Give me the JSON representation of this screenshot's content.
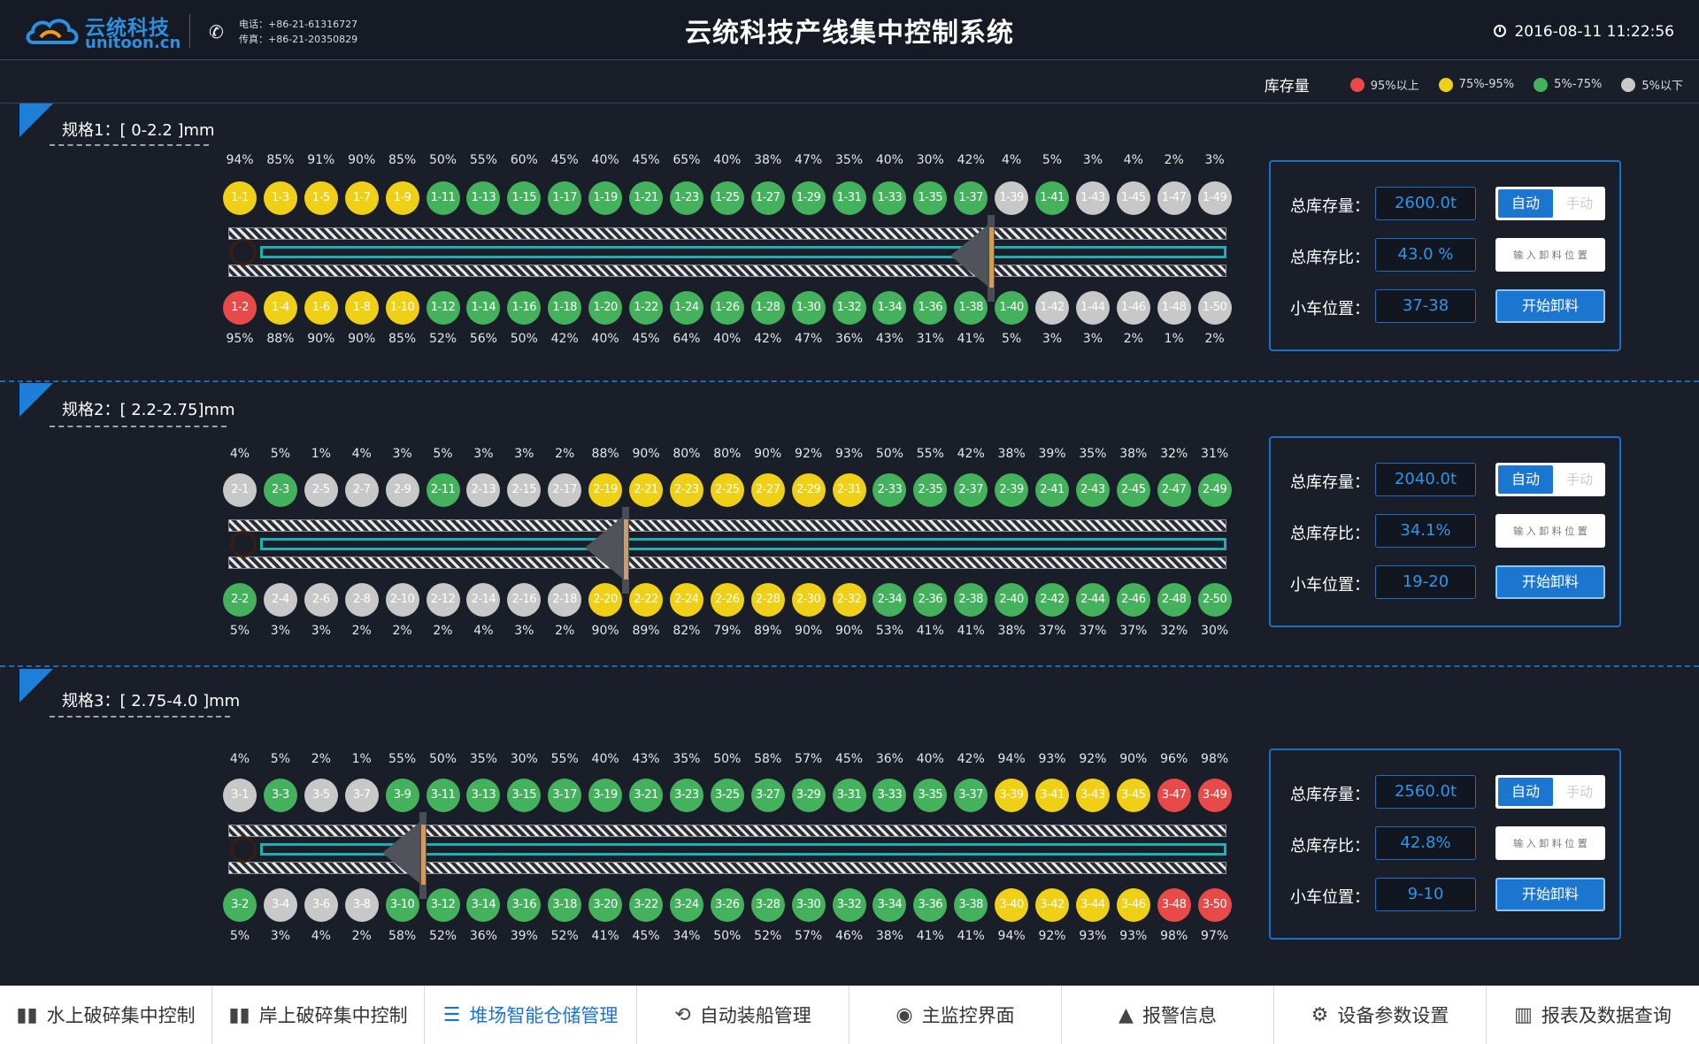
{
  "header": {
    "logo_cn": "云统科技",
    "logo_en": "unitoon.cn",
    "phone": "电话：+86-21-61316727",
    "fax": "传真：+86-21-20350829",
    "title": "云统科技产线集中控制系统",
    "datetime": "2016-08-11  11:22:56"
  },
  "legend": {
    "title": "库存量",
    "items": [
      {
        "label": "95%以上",
        "color": "#e84a4a"
      },
      {
        "label": "75%-95%",
        "color": "#f0cf17"
      },
      {
        "label": "5%-75%",
        "color": "#44b25c"
      },
      {
        "label": "5%以下",
        "color": "#c8c8c8"
      }
    ]
  },
  "colors": {
    "red": "#e84a4a",
    "yellow": "#f0cf17",
    "green": "#44b25c",
    "gray": "#c8c8c8",
    "accent": "#1b76cf",
    "belt": "#1ab0b4"
  },
  "sections": [
    {
      "title": "规格1：[ 0-2.2 ]mm",
      "top_pct": [
        "94%",
        "85%",
        "91%",
        "90%",
        "85%",
        "50%",
        "55%",
        "60%",
        "45%",
        "40%",
        "45%",
        "65%",
        "40%",
        "38%",
        "47%",
        "35%",
        "40%",
        "30%",
        "42%",
        "4%",
        "5%",
        "3%",
        "4%",
        "2%",
        "3%"
      ],
      "top_bins": [
        "1-1",
        "1-3",
        "1-5",
        "1-7",
        "1-9",
        "1-11",
        "1-13",
        "1-15",
        "1-17",
        "1-19",
        "1-21",
        "1-23",
        "1-25",
        "1-27",
        "1-29",
        "1-31",
        "1-33",
        "1-35",
        "1-37",
        "1-39",
        "1-41",
        "1-43",
        "1-45",
        "1-47",
        "1-49"
      ],
      "bottom_bins": [
        "1-2",
        "1-4",
        "1-6",
        "1-8",
        "1-10",
        "1-12",
        "1-14",
        "1-16",
        "1-18",
        "1-20",
        "1-22",
        "1-24",
        "1-26",
        "1-28",
        "1-30",
        "1-32",
        "1-34",
        "1-36",
        "1-38",
        "1-40",
        "1-42",
        "1-44",
        "1-46",
        "1-48",
        "1-50"
      ],
      "bottom_pct": [
        "95%",
        "88%",
        "90%",
        "90%",
        "85%",
        "52%",
        "56%",
        "50%",
        "42%",
        "40%",
        "45%",
        "64%",
        "40%",
        "42%",
        "47%",
        "36%",
        "43%",
        "31%",
        "41%",
        "5%",
        "3%",
        "3%",
        "2%",
        "1%",
        "2%"
      ],
      "trolley_slot": 19,
      "panel": {
        "stock_label": "总库存量：",
        "stock_value": "2600.0t",
        "ratio_label": "总库存比：",
        "ratio_value": "43.0 %",
        "position_label": "小车位置：",
        "position_value": "37-38",
        "auto_label": "自动",
        "manual_label": "手动",
        "input_placeholder": "输 入 卸 料 位 置",
        "start_label": "开始卸料"
      }
    },
    {
      "title": "规格2：[ 2.2-2.75]mm",
      "top_pct": [
        "4%",
        "5%",
        "1%",
        "4%",
        "3%",
        "5%",
        "3%",
        "3%",
        "2%",
        "88%",
        "90%",
        "80%",
        "80%",
        "90%",
        "92%",
        "93%",
        "50%",
        "55%",
        "42%",
        "38%",
        "39%",
        "35%",
        "38%",
        "32%",
        "31%"
      ],
      "top_bins": [
        "2-1",
        "2-3",
        "2-5",
        "2-7",
        "2-9",
        "2-11",
        "2-13",
        "2-15",
        "2-17",
        "2-19",
        "2-21",
        "2-23",
        "2-25",
        "2-27",
        "2-29",
        "2-31",
        "2-33",
        "2-35",
        "2-37",
        "2-39",
        "2-41",
        "2-43",
        "2-45",
        "2-47",
        "2-49"
      ],
      "bottom_bins": [
        "2-2",
        "2-4",
        "2-6",
        "2-8",
        "2-10",
        "2-12",
        "2-14",
        "2-16",
        "2-18",
        "2-20",
        "2-22",
        "2-24",
        "2-26",
        "2-28",
        "2-30",
        "2-32",
        "2-34",
        "2-36",
        "2-38",
        "2-40",
        "2-42",
        "2-44",
        "2-46",
        "2-48",
        "2-50"
      ],
      "bottom_pct": [
        "5%",
        "3%",
        "3%",
        "2%",
        "2%",
        "2%",
        "4%",
        "3%",
        "2%",
        "90%",
        "89%",
        "82%",
        "79%",
        "89%",
        "90%",
        "90%",
        "53%",
        "41%",
        "41%",
        "38%",
        "37%",
        "37%",
        "37%",
        "32%",
        "30%"
      ],
      "trolley_slot": 10,
      "panel": {
        "stock_label": "总库存量：",
        "stock_value": "2040.0t",
        "ratio_label": "总库存比：",
        "ratio_value": "34.1%",
        "position_label": "小车位置：",
        "position_value": "19-20",
        "auto_label": "自动",
        "manual_label": "手动",
        "input_placeholder": "输 入 卸 料 位 置",
        "start_label": "开始卸料"
      }
    },
    {
      "title": "规格3：[ 2.75-4.0 ]mm",
      "top_pct": [
        "4%",
        "5%",
        "2%",
        "1%",
        "55%",
        "50%",
        "35%",
        "30%",
        "55%",
        "40%",
        "43%",
        "35%",
        "50%",
        "58%",
        "57%",
        "45%",
        "36%",
        "40%",
        "42%",
        "94%",
        "93%",
        "92%",
        "90%",
        "96%",
        "98%"
      ],
      "top_bins": [
        "3-1",
        "3-3",
        "3-5",
        "3-7",
        "3-9",
        "3-11",
        "3-13",
        "3-15",
        "3-17",
        "3-19",
        "3-21",
        "3-23",
        "3-25",
        "3-27",
        "3-29",
        "3-31",
        "3-33",
        "3-35",
        "3-37",
        "3-39",
        "3-41",
        "3-43",
        "3-45",
        "3-47",
        "3-49"
      ],
      "bottom_bins": [
        "3-2",
        "3-4",
        "3-6",
        "3-8",
        "3-10",
        "3-12",
        "3-14",
        "3-16",
        "3-18",
        "3-20",
        "3-22",
        "3-24",
        "3-26",
        "3-28",
        "3-30",
        "3-32",
        "3-34",
        "3-36",
        "3-38",
        "3-40",
        "3-42",
        "3-44",
        "3-46",
        "3-48",
        "3-50"
      ],
      "bottom_pct": [
        "5%",
        "3%",
        "4%",
        "2%",
        "58%",
        "52%",
        "36%",
        "39%",
        "52%",
        "41%",
        "45%",
        "34%",
        "50%",
        "52%",
        "57%",
        "46%",
        "38%",
        "41%",
        "41%",
        "94%",
        "92%",
        "93%",
        "93%",
        "98%",
        "97%"
      ],
      "trolley_slot": 5,
      "panel": {
        "stock_label": "总库存量：",
        "stock_value": "2560.0t",
        "ratio_label": "总库存比：",
        "ratio_value": "42.8%",
        "position_label": "小车位置：",
        "position_value": "9-10",
        "auto_label": "自动",
        "manual_label": "手动",
        "input_placeholder": "输 入 卸 料 位 置",
        "start_label": "开始卸料"
      }
    }
  ],
  "nav": [
    {
      "label": "水上破碎集中控制",
      "icon": "bar-chart-icon",
      "glyph": "▮▮"
    },
    {
      "label": "岸上破碎集中控制",
      "icon": "bar-chart-icon",
      "glyph": "▮▮"
    },
    {
      "label": "堆场智能仓储管理",
      "icon": "list-icon",
      "glyph": "☰",
      "active": true
    },
    {
      "label": "自动装船管理",
      "icon": "refresh-icon",
      "glyph": "⟲"
    },
    {
      "label": "主监控界面",
      "icon": "camera-icon",
      "glyph": "◉"
    },
    {
      "label": "报警信息",
      "icon": "warning-icon",
      "glyph": "▲"
    },
    {
      "label": "设备参数设置",
      "icon": "gear-icon",
      "glyph": "⚙"
    },
    {
      "label": "报表及数据查询",
      "icon": "report-icon",
      "glyph": "▥"
    }
  ]
}
